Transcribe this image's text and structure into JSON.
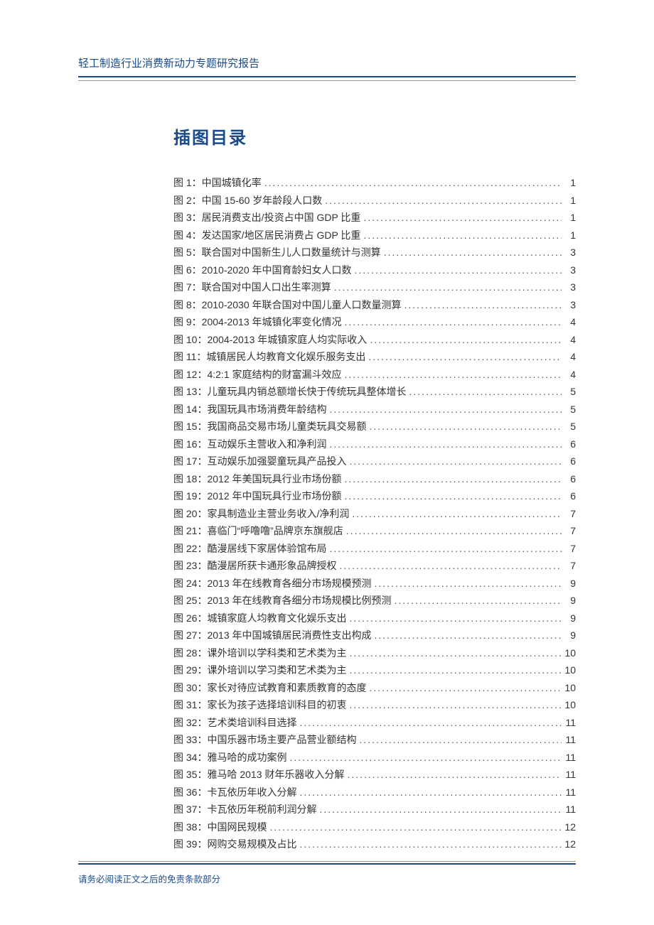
{
  "header": "轻工制造行业消费新动力专题研究报告",
  "toc_title": "插图目录",
  "footer": "请务必阅读正文之后的免责条款部分",
  "entries": [
    {
      "label": "图 1：中国城镇化率",
      "page": "1"
    },
    {
      "label": "图 2：中国 15-60 岁年龄段人口数",
      "page": "1"
    },
    {
      "label": "图 3：居民消费支出/投资占中国 GDP 比重",
      "page": "1"
    },
    {
      "label": "图 4：发达国家/地区居民消费占 GDP 比重",
      "page": "1"
    },
    {
      "label": "图 5：联合国对中国新生儿人口数量统计与测算",
      "page": "3"
    },
    {
      "label": "图 6：2010-2020 年中国育龄妇女人口数",
      "page": "3"
    },
    {
      "label": "图 7：联合国对中国人口出生率测算",
      "page": "3"
    },
    {
      "label": "图 8：2010-2030 年联合国对中国儿童人口数量测算",
      "page": "3"
    },
    {
      "label": "图 9：2004-2013 年城镇化率变化情况",
      "page": "4"
    },
    {
      "label": "图 10：2004-2013 年城镇家庭人均实际收入",
      "page": "4"
    },
    {
      "label": "图 11：城镇居民人均教育文化娱乐服务支出",
      "page": "4"
    },
    {
      "label": "图 12：4:2:1 家庭结构的财富漏斗效应",
      "page": "4"
    },
    {
      "label": "图 13：儿童玩具内销总额增长快于传统玩具整体增长",
      "page": "5"
    },
    {
      "label": "图 14：我国玩具市场消费年龄结构",
      "page": "5"
    },
    {
      "label": "图 15：我国商品交易市场儿童类玩具交易额",
      "page": "5"
    },
    {
      "label": "图 16：互动娱乐主营收入和净利润",
      "page": "6"
    },
    {
      "label": "图 17：互动娱乐加强婴童玩具产品投入",
      "page": "6"
    },
    {
      "label": "图 18：2012 年美国玩具行业市场份额",
      "page": "6"
    },
    {
      "label": "图 19：2012 年中国玩具行业市场份额",
      "page": "6"
    },
    {
      "label": "图 20：家具制造业主营业务收入/净利润",
      "page": "7"
    },
    {
      "label": "图 21：喜临门“呼噜噜”品牌京东旗舰店",
      "page": "7"
    },
    {
      "label": "图 22：酷漫居线下家居体验馆布局",
      "page": "7"
    },
    {
      "label": "图 23：酷漫居所获卡通形象品牌授权",
      "page": "7"
    },
    {
      "label": "图 24：2013 年在线教育各细分市场规模预测",
      "page": "9"
    },
    {
      "label": "图 25：2013 年在线教育各细分市场规模比例预测",
      "page": "9"
    },
    {
      "label": "图 26：城镇家庭人均教育文化娱乐支出",
      "page": "9"
    },
    {
      "label": "图 27：2013 年中国城镇居民消费性支出构成",
      "page": "9"
    },
    {
      "label": "图 28：课外培训以学科类和艺术类为主",
      "page": "10"
    },
    {
      "label": "图 29：课外培训以学习类和艺术类为主",
      "page": "10"
    },
    {
      "label": "图 30：家长对待应试教育和素质教育的态度",
      "page": "10"
    },
    {
      "label": "图 31：家长为孩子选择培训科目的初衷",
      "page": "10"
    },
    {
      "label": "图 32：艺术类培训科目选择",
      "page": "11"
    },
    {
      "label": "图 33：中国乐器市场主要产品营业额结构",
      "page": "11"
    },
    {
      "label": "图 34：雅马哈的成功案例",
      "page": "11"
    },
    {
      "label": "图 35：雅马哈 2013 财年乐器收入分解",
      "page": "11"
    },
    {
      "label": "图 36：卡瓦依历年收入分解",
      "page": "11"
    },
    {
      "label": "图 37：卡瓦依历年税前利润分解",
      "page": "11"
    },
    {
      "label": "图 38：中国网民规模",
      "page": "12"
    },
    {
      "label": "图 39：网购交易规模及占比",
      "page": "12"
    }
  ]
}
